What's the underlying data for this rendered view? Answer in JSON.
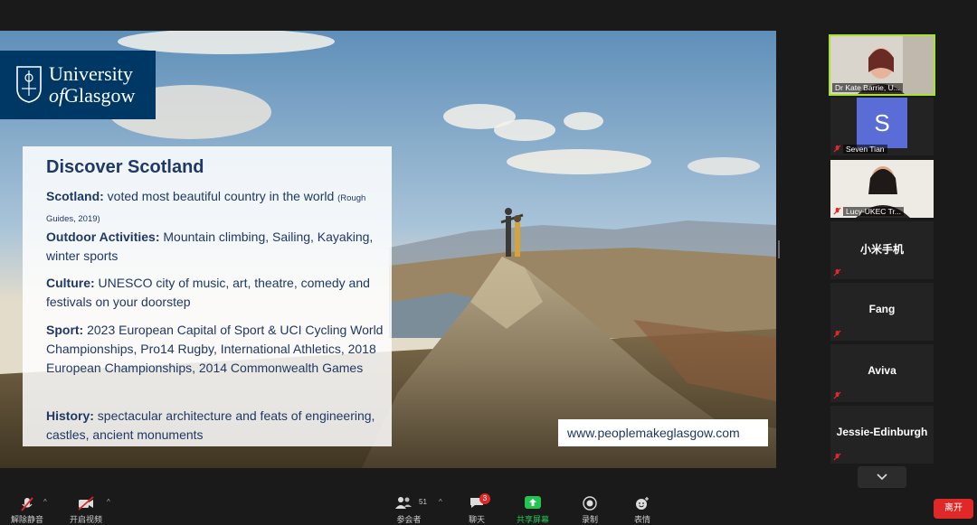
{
  "slide": {
    "logo_line1": "University",
    "logo_line2_prefix": "of",
    "logo_line2_rest": "Glasgow",
    "title": "Discover Scotland",
    "items": [
      {
        "head": "Scotland:",
        "text": " voted most beautiful country in the world ",
        "note": "(Rough Guides, 2019)"
      },
      {
        "head": "Outdoor Activities:",
        "text": " Mountain climbing, Sailing, Kayaking, winter sports",
        "note": ""
      },
      {
        "head": "Culture:",
        "text": "  UNESCO city of music, art, theatre, comedy and festivals on your doorstep",
        "note": ""
      },
      {
        "head": "Sport:",
        "text": "  2023 European Capital of Sport & UCI Cycling World  Championships, Pro14 Rugby, International Athletics, 2018 European Championships, 2014 Commonwealth Games",
        "note": ""
      },
      {
        "head": "History:",
        "text": " spectacular architecture and feats of engineering, castles, ancient monuments",
        "note": ""
      }
    ],
    "website": "www.peoplemakeglasgow.com"
  },
  "participants": [
    {
      "name": "Dr Kate Barrie, U...",
      "type": "video",
      "muted": false
    },
    {
      "name": "Seven Tian",
      "type": "avatar",
      "initial": "S",
      "muted": true
    },
    {
      "name": "Lucy-UKEC Tr...",
      "type": "video",
      "muted": true
    },
    {
      "name": "小米手机",
      "type": "name",
      "muted": true
    },
    {
      "name": "Fang",
      "type": "name",
      "muted": true
    },
    {
      "name": "Aviva",
      "type": "name",
      "muted": true
    },
    {
      "name": "Jessie-Edinburgh",
      "type": "name",
      "muted": true
    }
  ],
  "toolbar": {
    "unmute": "解除静音",
    "start_video": "开启视频",
    "participants": "参会者",
    "participants_count": "51",
    "chat": "聊天",
    "chat_badge": "3",
    "share": "共享屏幕",
    "record": "录制",
    "reactions": "表情",
    "leave": "离开"
  },
  "colors": {
    "accent_green": "#23c552",
    "leave_red": "#e02828",
    "uog_blue": "#003865",
    "active_speaker": "#a6e22e"
  }
}
